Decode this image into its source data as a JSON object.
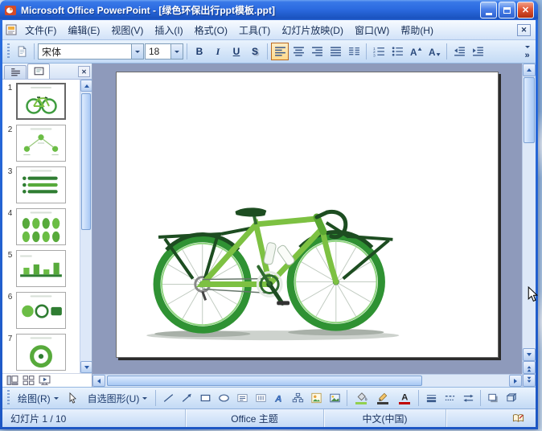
{
  "window": {
    "title": "Microsoft Office PowerPoint - [绿色环保出行ppt模板.ppt]"
  },
  "menus": [
    "文件(F)",
    "编辑(E)",
    "视图(V)",
    "插入(I)",
    "格式(O)",
    "工具(T)",
    "幻灯片放映(D)",
    "窗口(W)",
    "帮助(H)"
  ],
  "format_toolbar": {
    "font_name": "宋体",
    "font_size": "18",
    "bold": "B",
    "italic": "I",
    "underline": "U",
    "shadow_btn": "S"
  },
  "slides_panel": {
    "numbers": [
      "1",
      "2",
      "3",
      "4",
      "5",
      "6",
      "7"
    ]
  },
  "drawing_toolbar": {
    "draw": "绘图(R)",
    "autoshapes": "自选图形(U)"
  },
  "status_bar": {
    "slide_indicator": "幻灯片 1 / 10",
    "theme": "Office 主题",
    "language": "中文(中国)"
  },
  "icons": {
    "close": "✕",
    "overflow": "»"
  },
  "colors": {
    "workspace": "#8e9abb",
    "active-orange": "#ffd98c",
    "bike-green": "#7dc142",
    "bike-dark": "#1d4d21",
    "wheel-green": "#2f9233",
    "fill-swatch": "#92d050",
    "line-swatch": "#3a3a3a",
    "font-swatch": "#c00000"
  }
}
